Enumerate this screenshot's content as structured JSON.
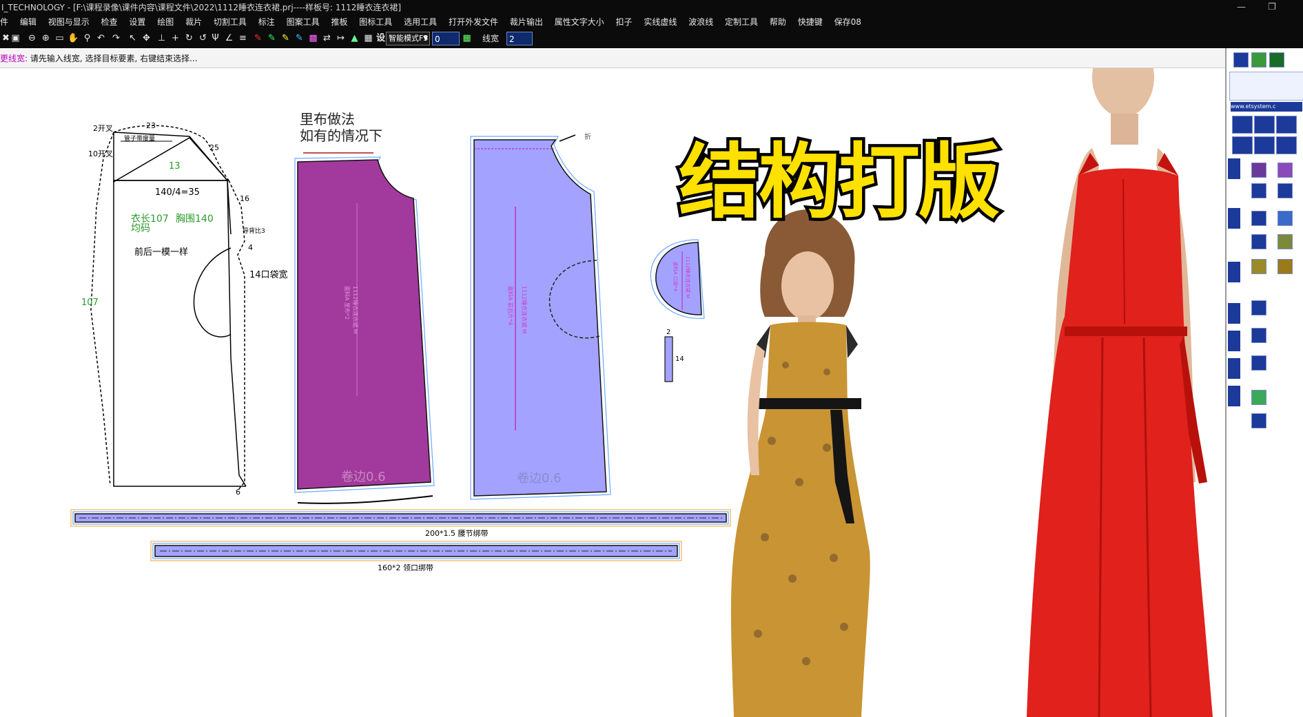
{
  "window": {
    "title": "I_TECHNOLOGY - [F:\\课程录像\\课件内容\\课程文件\\2022\\1112睡衣连衣裙.prj----样板号: 1112睡衣连衣裙]"
  },
  "menu": {
    "items": [
      "件",
      "编辑",
      "视图与显示",
      "检查",
      "设置",
      "绘图",
      "裁片",
      "切割工具",
      "标注",
      "图案工具",
      "推板",
      "图标工具",
      "选用工具",
      "打开外发文件",
      "裁片输出",
      "属性文字大小",
      "扣子",
      "实线虚线",
      "波浪线",
      "定制工具",
      "帮助",
      "快捷键",
      "保存08"
    ]
  },
  "toolbar": {
    "settings_label": "设",
    "mode_select": "智能模式F5",
    "value_field": "0",
    "linewidth_label": "线宽",
    "linewidth_value": "2"
  },
  "status": {
    "command": "更线宽:",
    "prompt": " 请先输入线宽, 选择目标要素, 右键结束选择..."
  },
  "overlay": {
    "title": "结构打版"
  },
  "draft": {
    "label_2kai": "2开叉",
    "label_10kai": "10开叉",
    "label_23": "23",
    "label_25": "25",
    "label_13": "13",
    "label_chest_formula": "140/4=35",
    "label_16": "16",
    "label_length": "衣长107",
    "label_bust": "胸围140",
    "label_size": "均码",
    "label_same": "前后一模一样",
    "label_107": "107",
    "label_daoya": "导背比3",
    "label_4": "4",
    "label_pocket": "14口袋宽",
    "label_6": "6",
    "label_fold": "管子带度量"
  },
  "lining_note": {
    "line1": "里布做法",
    "line2": "如有的情况下"
  },
  "pieces": {
    "purple_hem": "卷边0.6",
    "blue_hem": "卷边0.6",
    "blue_inner": "1112睡衣连衣裙 M",
    "blue_inner2": "面料A  前后片*4",
    "purple_inner": "1112睡衣连衣裙 M",
    "purple_inner2": "面料A  里布*2",
    "pocket_inner": "1112睡衣连衣裙 M",
    "pocket_inner2": "面料A  口袋*4",
    "strap_top": "2",
    "strap_side": "14",
    "waist_tie": "200*1.5  腰节绑带",
    "neck_tie": "160*2   领口绑带",
    "partial_label": "折"
  },
  "panel": {
    "url": "www.etsystem.c"
  },
  "colors": {
    "purple_piece": "#a13a9c",
    "blue_piece": "#a3a3ff",
    "title_yellow": "#ffe100",
    "dress_red": "#e0211c",
    "dress_yellow": "#c99433"
  }
}
